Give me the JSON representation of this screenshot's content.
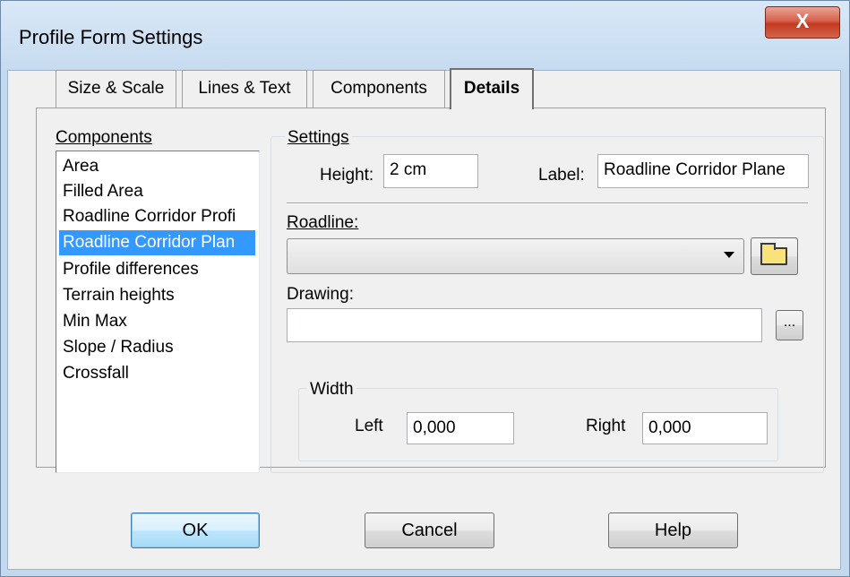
{
  "window": {
    "title": "Profile Form Settings",
    "close_label": "X"
  },
  "tabs": [
    {
      "label": "Size & Scale"
    },
    {
      "label": "Lines & Text"
    },
    {
      "label": "Components"
    },
    {
      "label": "Details",
      "active": true
    }
  ],
  "components": {
    "heading": "Components",
    "items": [
      "Area",
      "Filled Area",
      "Roadline Corridor Profi",
      "Roadline Corridor Plan",
      "Profile differences",
      "Terrain heights",
      "Min Max",
      "Slope / Radius",
      "Crossfall"
    ],
    "selected": "Roadline Corridor Plan"
  },
  "settings": {
    "heading": "Settings",
    "height_label": "Height:",
    "height_value": "2 cm",
    "label_label": "Label:",
    "label_value": "Roadline Corridor Plane",
    "roadline_label": "Roadline:",
    "roadline_value": "",
    "drawing_label": "Drawing:",
    "drawing_value": "",
    "browse_label": "...",
    "width": {
      "heading": "Width",
      "left_label": "Left",
      "left_value": "0,000",
      "right_label": "Right",
      "right_value": "0,000"
    }
  },
  "buttons": {
    "ok": "OK",
    "cancel": "Cancel",
    "help": "Help"
  },
  "icons": {
    "close": "close-icon",
    "folder": "folder-icon",
    "dropdown": "chevron-down-icon"
  }
}
